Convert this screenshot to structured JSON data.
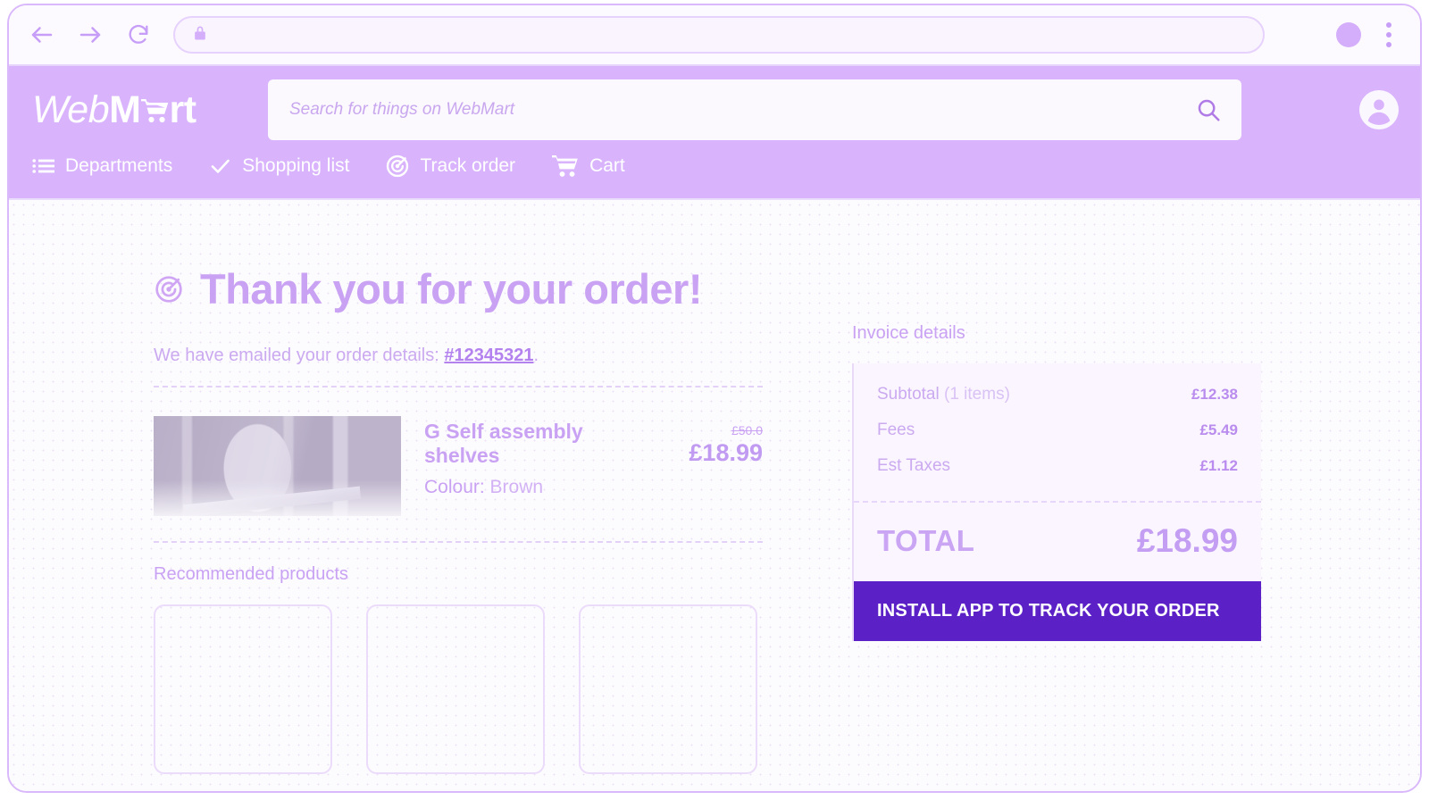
{
  "browser": {
    "back_icon": "back-arrow-icon",
    "forward_icon": "forward-arrow-icon",
    "reload_icon": "reload-icon",
    "lock_icon": "lock-icon",
    "url_value": "",
    "url_placeholder": "",
    "profile_icon": "profile-circle-icon",
    "menu_icon": "three-dot-menu-icon"
  },
  "header": {
    "logo": {
      "part1": "Web",
      "part2": "M",
      "cart_icon": "shopping-cart-icon",
      "part3": "rt"
    },
    "search": {
      "value": "",
      "placeholder": "Search for things on WebMart",
      "icon": "search-icon"
    },
    "account_icon": "user-account-icon",
    "nav": [
      {
        "label": "Departments",
        "icon": "list-menu-icon"
      },
      {
        "label": "Shopping list",
        "icon": "check-icon"
      },
      {
        "label": "Track order",
        "icon": "target-radar-icon"
      },
      {
        "label": "Cart",
        "icon": "shopping-cart-icon"
      }
    ]
  },
  "main": {
    "thanks_icon": "target-radar-icon",
    "thanks_title": "Thank you for your order!",
    "emailed_prefix": "We have emailed your order details: ",
    "order_number": "#12345321",
    "emailed_suffix": ".",
    "item": {
      "image_alt": "product-photo",
      "title": "G Self assembly shelves",
      "colour_label": "Colour:",
      "colour_value": "Brown",
      "price_old": "£50.0",
      "price_new": "£18.99"
    },
    "recommended_title": "Recommended products",
    "recommended_cards": [
      {
        "label": ""
      },
      {
        "label": ""
      },
      {
        "label": ""
      }
    ]
  },
  "invoice": {
    "title": "Invoice details",
    "rows": [
      {
        "label": "Subtotal",
        "label_muted": " (1 items)",
        "value": "£12.38"
      },
      {
        "label": "Fees",
        "label_muted": "",
        "value": "£5.49"
      },
      {
        "label": "Est Taxes",
        "label_muted": "",
        "value": "£1.12"
      }
    ],
    "total_label": "TOTAL",
    "total_value": "£18.99",
    "install_button": "INSTALL APP TO TRACK YOUR ORDER"
  },
  "colors": {
    "header_purple": "#d9b4fd",
    "accent_purple": "#c9a2f3",
    "deep_purple": "#5b21c7",
    "page_bg": "#fcfbfe"
  }
}
